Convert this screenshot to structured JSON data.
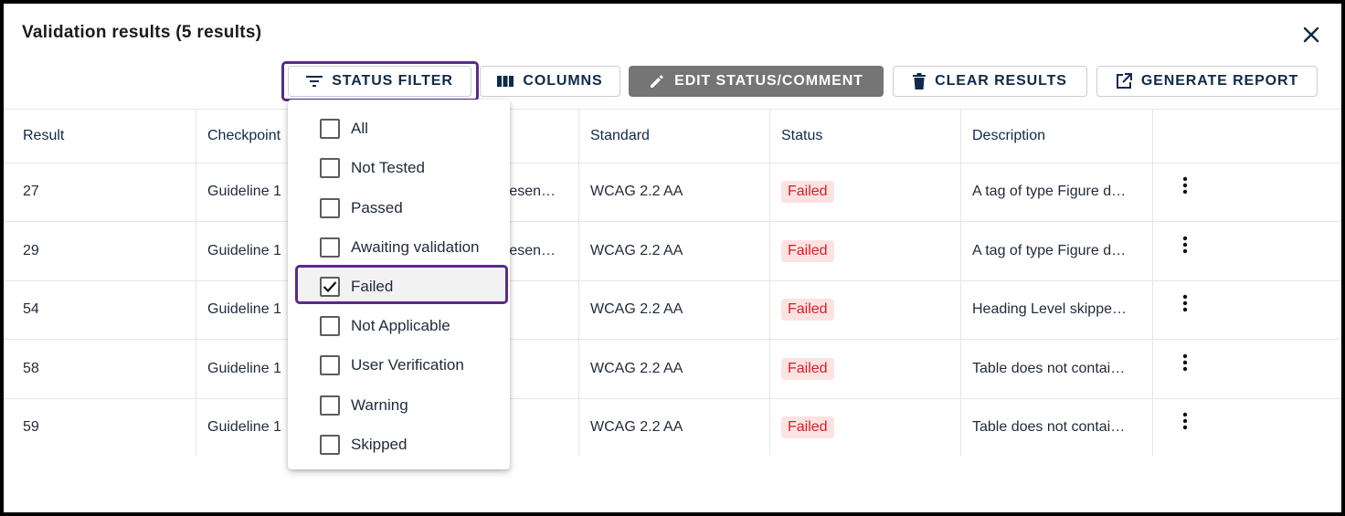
{
  "dialog": {
    "title": "Validation results (5 results)"
  },
  "toolbar": {
    "status_filter_label": "STATUS FILTER",
    "columns_label": "COLUMNS",
    "edit_label": "EDIT STATUS/COMMENT",
    "clear_label": "CLEAR RESULTS",
    "report_label": "GENERATE REPORT"
  },
  "table": {
    "headers": [
      "Result",
      "Checkpoint",
      "",
      "Standard",
      "Status",
      "Description"
    ],
    "rows": [
      {
        "result": "27",
        "checkpoint": "Guideline 1",
        "col3": "resen…",
        "standard": "WCAG 2.2 AA",
        "status": "Failed",
        "description": "A tag of type Figure d…"
      },
      {
        "result": "29",
        "checkpoint": "Guideline 1",
        "col3": "resen…",
        "standard": "WCAG 2.2 AA",
        "status": "Failed",
        "description": "A tag of type Figure d…"
      },
      {
        "result": "54",
        "checkpoint": "Guideline 1",
        "col3": "",
        "standard": "WCAG 2.2 AA",
        "status": "Failed",
        "description": "Heading Level skippe…"
      },
      {
        "result": "58",
        "checkpoint": "Guideline 1",
        "col3": "",
        "standard": "WCAG 2.2 AA",
        "status": "Failed",
        "description": "Table does not contai…"
      },
      {
        "result": "59",
        "checkpoint": "Guideline 1",
        "col3": "",
        "standard": "WCAG 2.2 AA",
        "status": "Failed",
        "description": "Table does not contai…"
      }
    ]
  },
  "status_filter": {
    "options": [
      {
        "label": "All",
        "checked": false
      },
      {
        "label": "Not Tested",
        "checked": false
      },
      {
        "label": "Passed",
        "checked": false
      },
      {
        "label": "Awaiting validation",
        "checked": false
      },
      {
        "label": "Failed",
        "checked": true
      },
      {
        "label": "Not Applicable",
        "checked": false
      },
      {
        "label": "User Verification",
        "checked": false
      },
      {
        "label": "Warning",
        "checked": false
      },
      {
        "label": "Skipped",
        "checked": false
      }
    ]
  },
  "colors": {
    "highlight": "#5b2a86",
    "failed_text": "#d21f2a",
    "failed_bg": "#fde2e2",
    "edit_button_bg": "#757575"
  },
  "icons": {
    "close": "close-icon",
    "filter": "filter-icon",
    "columns": "columns-icon",
    "edit": "pencil-icon",
    "clear": "trash-icon",
    "report": "open-external-icon",
    "row_menu": "more-vertical-icon",
    "checkbox_checked": "checkmark-icon"
  }
}
